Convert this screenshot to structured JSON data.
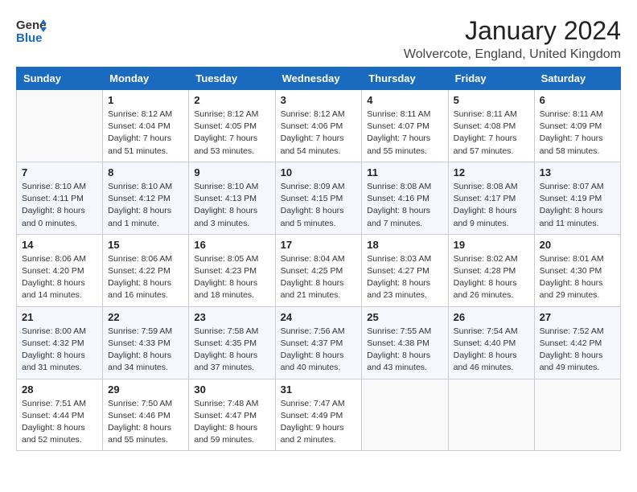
{
  "header": {
    "logo_general": "General",
    "logo_blue": "Blue",
    "title": "January 2024",
    "location": "Wolvercote, England, United Kingdom"
  },
  "weekdays": [
    "Sunday",
    "Monday",
    "Tuesday",
    "Wednesday",
    "Thursday",
    "Friday",
    "Saturday"
  ],
  "weeks": [
    [
      {
        "day": "",
        "info": ""
      },
      {
        "day": "1",
        "info": "Sunrise: 8:12 AM\nSunset: 4:04 PM\nDaylight: 7 hours\nand 51 minutes."
      },
      {
        "day": "2",
        "info": "Sunrise: 8:12 AM\nSunset: 4:05 PM\nDaylight: 7 hours\nand 53 minutes."
      },
      {
        "day": "3",
        "info": "Sunrise: 8:12 AM\nSunset: 4:06 PM\nDaylight: 7 hours\nand 54 minutes."
      },
      {
        "day": "4",
        "info": "Sunrise: 8:11 AM\nSunset: 4:07 PM\nDaylight: 7 hours\nand 55 minutes."
      },
      {
        "day": "5",
        "info": "Sunrise: 8:11 AM\nSunset: 4:08 PM\nDaylight: 7 hours\nand 57 minutes."
      },
      {
        "day": "6",
        "info": "Sunrise: 8:11 AM\nSunset: 4:09 PM\nDaylight: 7 hours\nand 58 minutes."
      }
    ],
    [
      {
        "day": "7",
        "info": "Sunrise: 8:10 AM\nSunset: 4:11 PM\nDaylight: 8 hours\nand 0 minutes."
      },
      {
        "day": "8",
        "info": "Sunrise: 8:10 AM\nSunset: 4:12 PM\nDaylight: 8 hours\nand 1 minute."
      },
      {
        "day": "9",
        "info": "Sunrise: 8:10 AM\nSunset: 4:13 PM\nDaylight: 8 hours\nand 3 minutes."
      },
      {
        "day": "10",
        "info": "Sunrise: 8:09 AM\nSunset: 4:15 PM\nDaylight: 8 hours\nand 5 minutes."
      },
      {
        "day": "11",
        "info": "Sunrise: 8:08 AM\nSunset: 4:16 PM\nDaylight: 8 hours\nand 7 minutes."
      },
      {
        "day": "12",
        "info": "Sunrise: 8:08 AM\nSunset: 4:17 PM\nDaylight: 8 hours\nand 9 minutes."
      },
      {
        "day": "13",
        "info": "Sunrise: 8:07 AM\nSunset: 4:19 PM\nDaylight: 8 hours\nand 11 minutes."
      }
    ],
    [
      {
        "day": "14",
        "info": "Sunrise: 8:06 AM\nSunset: 4:20 PM\nDaylight: 8 hours\nand 14 minutes."
      },
      {
        "day": "15",
        "info": "Sunrise: 8:06 AM\nSunset: 4:22 PM\nDaylight: 8 hours\nand 16 minutes."
      },
      {
        "day": "16",
        "info": "Sunrise: 8:05 AM\nSunset: 4:23 PM\nDaylight: 8 hours\nand 18 minutes."
      },
      {
        "day": "17",
        "info": "Sunrise: 8:04 AM\nSunset: 4:25 PM\nDaylight: 8 hours\nand 21 minutes."
      },
      {
        "day": "18",
        "info": "Sunrise: 8:03 AM\nSunset: 4:27 PM\nDaylight: 8 hours\nand 23 minutes."
      },
      {
        "day": "19",
        "info": "Sunrise: 8:02 AM\nSunset: 4:28 PM\nDaylight: 8 hours\nand 26 minutes."
      },
      {
        "day": "20",
        "info": "Sunrise: 8:01 AM\nSunset: 4:30 PM\nDaylight: 8 hours\nand 29 minutes."
      }
    ],
    [
      {
        "day": "21",
        "info": "Sunrise: 8:00 AM\nSunset: 4:32 PM\nDaylight: 8 hours\nand 31 minutes."
      },
      {
        "day": "22",
        "info": "Sunrise: 7:59 AM\nSunset: 4:33 PM\nDaylight: 8 hours\nand 34 minutes."
      },
      {
        "day": "23",
        "info": "Sunrise: 7:58 AM\nSunset: 4:35 PM\nDaylight: 8 hours\nand 37 minutes."
      },
      {
        "day": "24",
        "info": "Sunrise: 7:56 AM\nSunset: 4:37 PM\nDaylight: 8 hours\nand 40 minutes."
      },
      {
        "day": "25",
        "info": "Sunrise: 7:55 AM\nSunset: 4:38 PM\nDaylight: 8 hours\nand 43 minutes."
      },
      {
        "day": "26",
        "info": "Sunrise: 7:54 AM\nSunset: 4:40 PM\nDaylight: 8 hours\nand 46 minutes."
      },
      {
        "day": "27",
        "info": "Sunrise: 7:52 AM\nSunset: 4:42 PM\nDaylight: 8 hours\nand 49 minutes."
      }
    ],
    [
      {
        "day": "28",
        "info": "Sunrise: 7:51 AM\nSunset: 4:44 PM\nDaylight: 8 hours\nand 52 minutes."
      },
      {
        "day": "29",
        "info": "Sunrise: 7:50 AM\nSunset: 4:46 PM\nDaylight: 8 hours\nand 55 minutes."
      },
      {
        "day": "30",
        "info": "Sunrise: 7:48 AM\nSunset: 4:47 PM\nDaylight: 8 hours\nand 59 minutes."
      },
      {
        "day": "31",
        "info": "Sunrise: 7:47 AM\nSunset: 4:49 PM\nDaylight: 9 hours\nand 2 minutes."
      },
      {
        "day": "",
        "info": ""
      },
      {
        "day": "",
        "info": ""
      },
      {
        "day": "",
        "info": ""
      }
    ]
  ]
}
